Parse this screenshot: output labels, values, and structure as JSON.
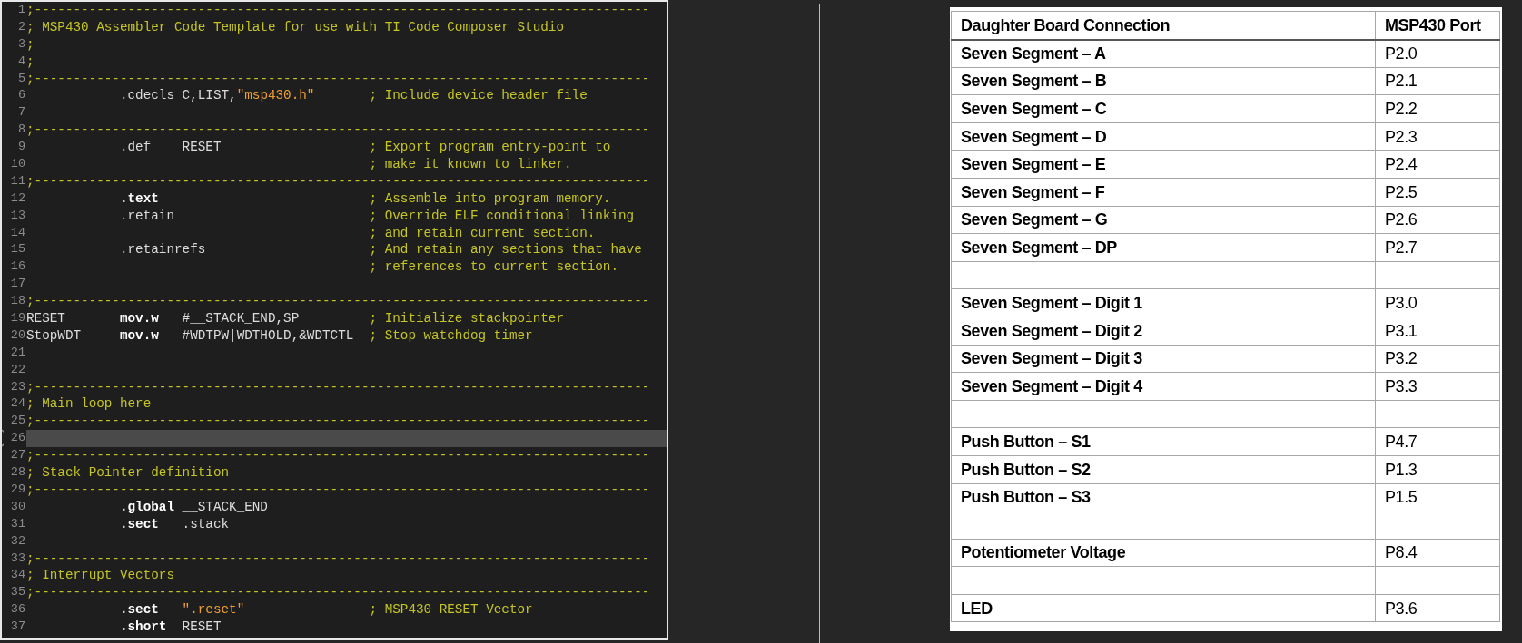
{
  "code": {
    "lines": [
      {
        "number": "1",
        "kind": "comment",
        "comment": ";-------------------------------------------------------------------------------"
      },
      {
        "number": "2",
        "kind": "comment",
        "comment": "; MSP430 Assembler Code Template for use with TI Code Composer Studio"
      },
      {
        "number": "3",
        "kind": "comment",
        "comment": ";"
      },
      {
        "number": "4",
        "kind": "comment",
        "comment": ";"
      },
      {
        "number": "5",
        "kind": "comment",
        "comment": ";-------------------------------------------------------------------------------"
      },
      {
        "number": "6",
        "kind": "code",
        "op": {
          "text": ".cdecls",
          "bold": false
        },
        "args": [
          {
            "kind": "plain",
            "text": "C,LIST,"
          },
          {
            "kind": "string",
            "text": "\"msp430.h\""
          }
        ],
        "comment": "; Include device header file"
      },
      {
        "number": "7",
        "kind": "empty"
      },
      {
        "number": "8",
        "kind": "comment",
        "comment": ";-------------------------------------------------------------------------------"
      },
      {
        "number": "9",
        "kind": "code",
        "op": {
          "text": ".def",
          "bold": false
        },
        "args": [
          {
            "kind": "plain",
            "text": "RESET"
          }
        ],
        "comment": "; Export program entry-point to"
      },
      {
        "number": "10",
        "kind": "code",
        "comment": "; make it known to linker."
      },
      {
        "number": "11",
        "kind": "comment",
        "comment": ";-------------------------------------------------------------------------------"
      },
      {
        "number": "12",
        "kind": "code",
        "op": {
          "text": ".text",
          "bold": true
        },
        "comment": "; Assemble into program memory."
      },
      {
        "number": "13",
        "kind": "code",
        "op": {
          "text": ".retain",
          "bold": false
        },
        "comment": "; Override ELF conditional linking"
      },
      {
        "number": "14",
        "kind": "code",
        "comment": "; and retain current section."
      },
      {
        "number": "15",
        "kind": "code",
        "op": {
          "text": ".retainrefs",
          "bold": false
        },
        "comment": "; And retain any sections that have"
      },
      {
        "number": "16",
        "kind": "code",
        "comment": "; references to current section."
      },
      {
        "number": "17",
        "kind": "empty"
      },
      {
        "number": "18",
        "kind": "comment",
        "comment": ";-------------------------------------------------------------------------------"
      },
      {
        "number": "19",
        "kind": "code",
        "label": "RESET",
        "op": {
          "text": "mov.w",
          "bold": true
        },
        "args": [
          {
            "kind": "plain",
            "text": "#__STACK_END,SP"
          }
        ],
        "comment": "; Initialize stackpointer"
      },
      {
        "number": "20",
        "kind": "code",
        "label": "StopWDT",
        "op": {
          "text": "mov.w",
          "bold": true
        },
        "args": [
          {
            "kind": "plain",
            "text": "#WDTPW|WDTHOLD,&WDTCTL"
          }
        ],
        "comment": "; Stop watchdog timer"
      },
      {
        "number": "21",
        "kind": "empty"
      },
      {
        "number": "22",
        "kind": "empty"
      },
      {
        "number": "23",
        "kind": "comment",
        "comment": ";-------------------------------------------------------------------------------"
      },
      {
        "number": "24",
        "kind": "comment",
        "comment": "; Main loop here"
      },
      {
        "number": "25",
        "kind": "comment",
        "comment": ";-------------------------------------------------------------------------------"
      },
      {
        "number": "26",
        "kind": "empty",
        "current": true
      },
      {
        "number": "27",
        "kind": "comment",
        "comment": ";-------------------------------------------------------------------------------"
      },
      {
        "number": "28",
        "kind": "comment",
        "comment": "; Stack Pointer definition"
      },
      {
        "number": "29",
        "kind": "comment",
        "comment": ";-------------------------------------------------------------------------------"
      },
      {
        "number": "30",
        "kind": "code",
        "op": {
          "text": ".global",
          "bold": true
        },
        "args": [
          {
            "kind": "plain",
            "text": "__STACK_END"
          }
        ]
      },
      {
        "number": "31",
        "kind": "code",
        "op": {
          "text": ".sect",
          "bold": true
        },
        "args": [
          {
            "kind": "plain",
            "text": ".stack"
          }
        ]
      },
      {
        "number": "32",
        "kind": "empty"
      },
      {
        "number": "33",
        "kind": "comment",
        "comment": ";-------------------------------------------------------------------------------"
      },
      {
        "number": "34",
        "kind": "comment",
        "comment": "; Interrupt Vectors"
      },
      {
        "number": "35",
        "kind": "comment",
        "comment": ";-------------------------------------------------------------------------------"
      },
      {
        "number": "36",
        "kind": "code",
        "op": {
          "text": ".sect",
          "bold": true
        },
        "args": [
          {
            "kind": "string",
            "text": "\".reset\""
          }
        ],
        "comment": "; MSP430 RESET Vector"
      },
      {
        "number": "37",
        "kind": "code",
        "op": {
          "text": ".short",
          "bold": true
        },
        "args": [
          {
            "kind": "plain",
            "text": "RESET"
          }
        ]
      }
    ]
  },
  "table": {
    "columns": [
      "Daughter Board Connection",
      "MSP430 Port"
    ],
    "rows": [
      {
        "kind": "pin",
        "connection": "Seven Segment – A",
        "port": "P2.0"
      },
      {
        "kind": "pin",
        "connection": "Seven Segment – B",
        "port": "P2.1"
      },
      {
        "kind": "pin",
        "connection": "Seven Segment – C",
        "port": "P2.2"
      },
      {
        "kind": "pin",
        "connection": "Seven Segment – D",
        "port": "P2.3"
      },
      {
        "kind": "pin",
        "connection": "Seven Segment – E",
        "port": "P2.4"
      },
      {
        "kind": "pin",
        "connection": "Seven Segment – F",
        "port": "P2.5"
      },
      {
        "kind": "pin",
        "connection": "Seven Segment – G",
        "port": "P2.6"
      },
      {
        "kind": "pin",
        "connection": "Seven Segment – DP",
        "port": "P2.7"
      },
      {
        "kind": "blank"
      },
      {
        "kind": "pin",
        "connection": "Seven Segment – Digit 1",
        "port": "P3.0"
      },
      {
        "kind": "pin",
        "connection": "Seven Segment – Digit 2",
        "port": "P3.1"
      },
      {
        "kind": "pin",
        "connection": "Seven Segment – Digit 3",
        "port": "P3.2"
      },
      {
        "kind": "pin",
        "connection": "Seven Segment – Digit 4",
        "port": "P3.3"
      },
      {
        "kind": "blank"
      },
      {
        "kind": "pin",
        "connection": "Push Button – S1",
        "port": "P4.7"
      },
      {
        "kind": "pin",
        "connection": "Push Button – S2",
        "port": "P1.3"
      },
      {
        "kind": "pin",
        "connection": "Push Button – S3",
        "port": "P1.5"
      },
      {
        "kind": "blank"
      },
      {
        "kind": "pin",
        "connection": "Potentiometer Voltage",
        "port": "P8.4"
      },
      {
        "kind": "blank"
      },
      {
        "kind": "pin",
        "connection": "LED",
        "port": "P3.6"
      }
    ]
  }
}
